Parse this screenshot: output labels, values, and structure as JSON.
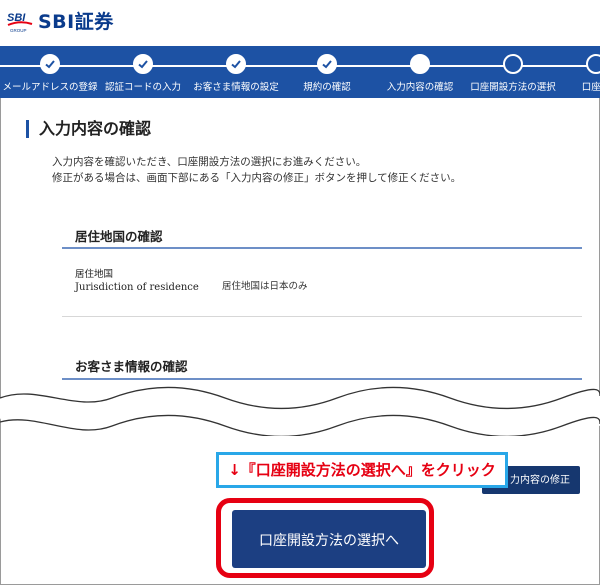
{
  "header": {
    "logo_mark_text": "SBI",
    "logo_mark_sub": "GROUP",
    "logo_text": "SBI証券"
  },
  "steps": [
    {
      "label": "メールアドレスの登録",
      "state": "done"
    },
    {
      "label": "認証コードの入力",
      "state": "done"
    },
    {
      "label": "お客さま情報の設定",
      "state": "done"
    },
    {
      "label": "規約の確認",
      "state": "done"
    },
    {
      "label": "入力内容の確認",
      "state": "current"
    },
    {
      "label": "口座開設方法の選択",
      "state": "todo"
    },
    {
      "label": "口座開",
      "state": "todo"
    }
  ],
  "page": {
    "title": "入力内容の確認",
    "intro_line1": "入力内容を確認いただき、口座開設方法の選択にお進みください。",
    "intro_line2": "修正がある場合は、画面下部にある「入力内容の修正」ボタンを押して修正ください。"
  },
  "residence": {
    "title": "居住地国の確認",
    "label_ja": "居住地国",
    "label_en": "Jurisdiction of residence",
    "value": "居住地国は日本のみ"
  },
  "customer": {
    "title": "お客さま情報の確認"
  },
  "buttons": {
    "modify": "力内容の修正",
    "proceed": "口座開設方法の選択へ"
  },
  "callout": {
    "text": "↓『口座開設方法の選択へ』をクリック"
  },
  "colors": {
    "brand": "#1d52a4",
    "accent": "#e60012",
    "callout_border": "#29a7e8"
  }
}
